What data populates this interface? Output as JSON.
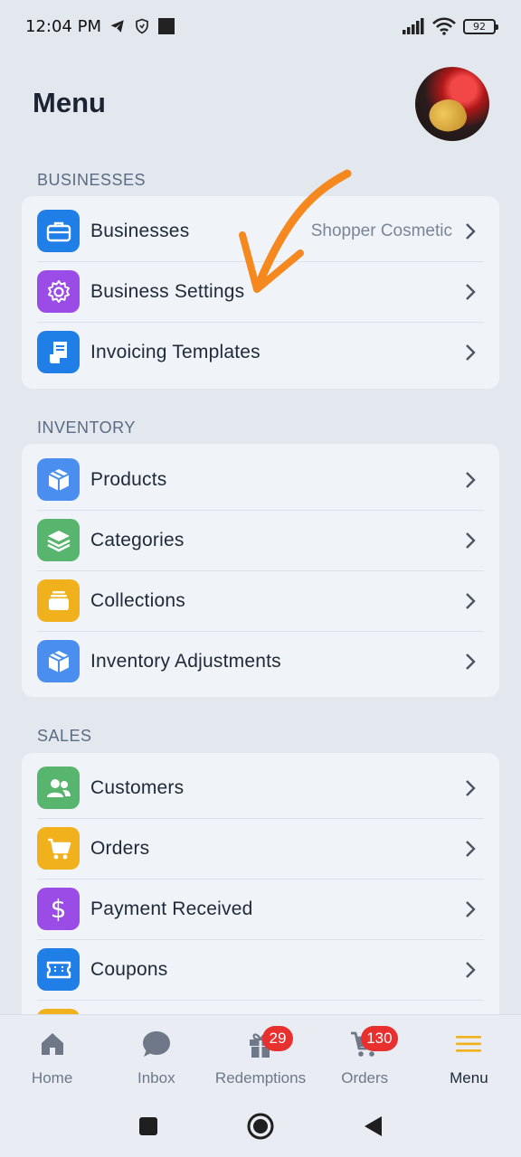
{
  "status_bar": {
    "time": "12:04 PM",
    "battery": "92"
  },
  "header": {
    "title": "Menu"
  },
  "sections": {
    "businesses": {
      "label": "BUSINESSES",
      "items": [
        {
          "label": "Businesses",
          "value": "Shopper Cosmetic",
          "icon": "briefcase-icon"
        },
        {
          "label": "Business Settings",
          "icon": "gear-icon"
        },
        {
          "label": "Invoicing Templates",
          "icon": "receipt-icon"
        }
      ]
    },
    "inventory": {
      "label": "INVENTORY",
      "items": [
        {
          "label": "Products",
          "icon": "box-icon"
        },
        {
          "label": "Categories",
          "icon": "layers-icon"
        },
        {
          "label": "Collections",
          "icon": "collection-icon"
        },
        {
          "label": "Inventory Adjustments",
          "icon": "box-icon"
        }
      ]
    },
    "sales": {
      "label": "SALES",
      "items": [
        {
          "label": "Customers",
          "icon": "users-icon"
        },
        {
          "label": "Orders",
          "icon": "cart-icon"
        },
        {
          "label": "Payment Received",
          "icon": "dollar-icon"
        },
        {
          "label": "Coupons",
          "icon": "ticket-icon"
        }
      ]
    }
  },
  "bottom_nav": {
    "items": [
      {
        "label": "Home",
        "icon": "home-icon"
      },
      {
        "label": "Inbox",
        "icon": "chat-icon"
      },
      {
        "label": "Redemptions",
        "icon": "gift-icon",
        "badge": "29"
      },
      {
        "label": "Orders",
        "icon": "cart-icon",
        "badge": "130"
      },
      {
        "label": "Menu",
        "icon": "menu-icon",
        "active": true
      }
    ]
  },
  "colors": {
    "accent_menu": "#f0b11c",
    "badge": "#e8302f",
    "annotation_arrow": "#f5891f"
  }
}
